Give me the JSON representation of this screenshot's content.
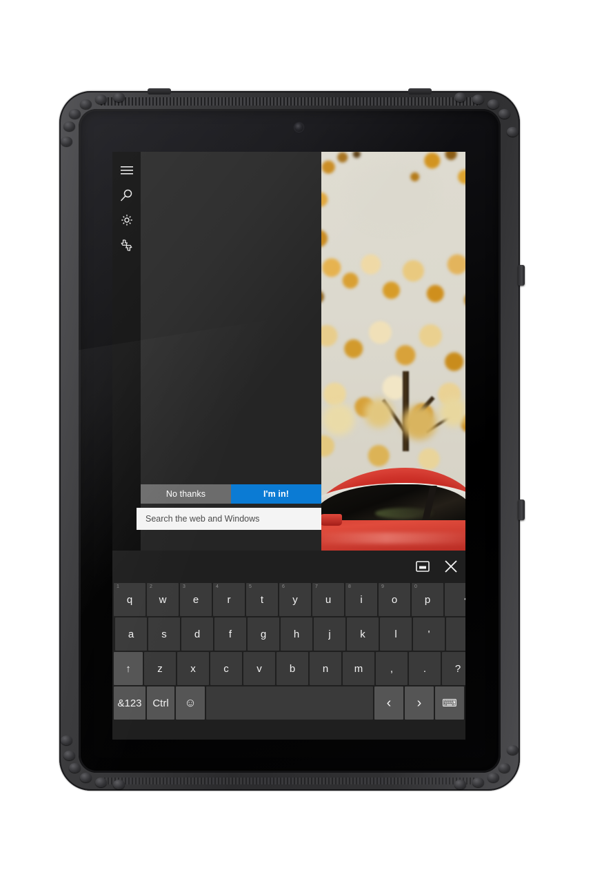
{
  "device": {
    "name": "rugged-windows-tablet",
    "bezel_color": "#2d2d2f",
    "screen_color": "#000000"
  },
  "cortana": {
    "rail": [
      {
        "name": "hamburger-menu-icon",
        "label": "Menu"
      },
      {
        "name": "search-icon",
        "label": "Search"
      },
      {
        "name": "gear-icon",
        "label": "Settings"
      },
      {
        "name": "feedback-icon",
        "label": "Feedback"
      }
    ],
    "prompt": {
      "decline_label": "No thanks",
      "accept_label": "I'm in!",
      "decline_color": "#6c6c6c",
      "accept_color": "#0b7bd4"
    },
    "search": {
      "placeholder": "Search the web and Windows",
      "value": ""
    }
  },
  "keyboard": {
    "tools": [
      {
        "name": "dock-undock-icon",
        "label": "Dock"
      },
      {
        "name": "close-icon",
        "label": "Close"
      }
    ],
    "row1": [
      {
        "key": "q",
        "hint": "1"
      },
      {
        "key": "w",
        "hint": "2"
      },
      {
        "key": "e",
        "hint": "3"
      },
      {
        "key": "r",
        "hint": "4"
      },
      {
        "key": "t",
        "hint": "5"
      },
      {
        "key": "y",
        "hint": "6"
      },
      {
        "key": "u",
        "hint": "7"
      },
      {
        "key": "i",
        "hint": "8"
      },
      {
        "key": "o",
        "hint": "9"
      },
      {
        "key": "p",
        "hint": "0"
      }
    ],
    "backspace_label": "⌫",
    "row2": [
      "a",
      "s",
      "d",
      "f",
      "g",
      "h",
      "j",
      "k",
      "l",
      "'"
    ],
    "enter_label": "↵",
    "row3": [
      "z",
      "x",
      "c",
      "v",
      "b",
      "n",
      "m",
      ",",
      ".",
      "?"
    ],
    "shift_left_label": "↑",
    "shift_right_label": "↑",
    "row4": {
      "symbols_label": "&123",
      "ctrl_label": "Ctrl",
      "emoji_label": "☺",
      "space_label": "",
      "prev_label": "‹",
      "next_label": "›",
      "hide_label": "⌨"
    }
  },
  "wallpaper": {
    "description": "autumn-tree-and-red-car-photo"
  }
}
